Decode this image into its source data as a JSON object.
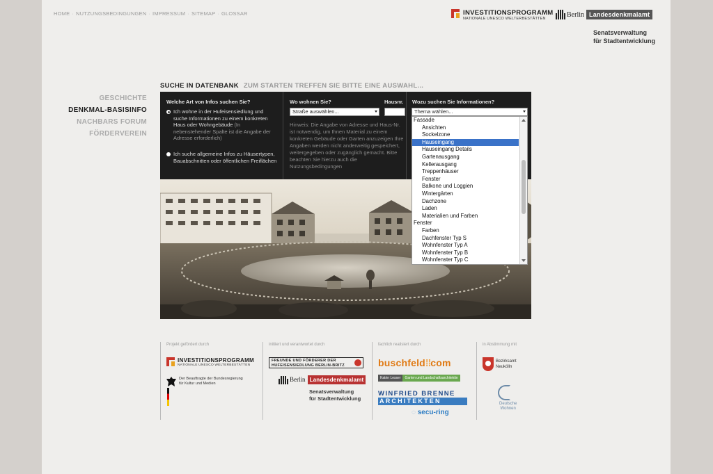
{
  "topnav": [
    "HOME",
    "NUTZUNGSBEDINGUNGEN",
    "IMPRESSUM",
    "SITEMAP",
    "GLOSSAR"
  ],
  "topnav_sep": "·",
  "header": {
    "ip_title": "INVESTITIONSPROGRAMM",
    "ip_sub": "NATIONALE UNESCO WELTERBESTÄTTEN",
    "berlin": "Berlin",
    "landesdenkmalamt": "Landesdenkmalamt",
    "senats_1": "Senatsverwaltung",
    "senats_2": "für Stadtentwicklung"
  },
  "sidenav": [
    "GESCHICHTE",
    "DENKMAL-BASISINFO",
    "NACHBARS FORUM",
    "FÖRDERVEREIN"
  ],
  "sidenav_active": 1,
  "search": {
    "title": "SUCHE IN DATENBANK",
    "subtitle": "ZUM STARTEN TREFFEN SIE BITTE EINE AUSWAHL...",
    "col1_heading": "Welche Art von Infos suchen Sie?",
    "radio1": "Ich wohne in der Hufeisensiedlung und suche Informationen zu einem konkreten Haus oder Wohngebäude",
    "radio1_note": "(In nebenstehender Spalte ist die Angabe der Adresse erforderlich)",
    "radio2": "Ich suche allgemeine Infos zu Häusertypen, Bauabschnitten oder öffentlichen Freiflächen",
    "col2_heading": "Wo wohnen Sie?",
    "hausnr_heading": "Hausnr.",
    "street_select": "Straße auswählen...",
    "hausnr_value": "",
    "hint": "Hinweis: Die Angabe von Adresse und Haus-Nr. ist notwendig, um Ihnen Material zu einem konkreten Gebäude oder Garten anzuzeigen Ihre Angaben werden nicht anderweitig gespeichert, weitergegeben oder zugänglich gemacht. Bitte beachten Sie hierzu auch die Nutzungsbedingungen",
    "col3_heading": "Wozu suchen Sie Informationen?",
    "topic_select": "Thema wählen..."
  },
  "dropdown": [
    {
      "label": "Fassade",
      "group": true
    },
    {
      "label": "Ansichten"
    },
    {
      "label": "Sockelzone"
    },
    {
      "label": "Hauseingang",
      "selected": true
    },
    {
      "label": "Hauseingang Details"
    },
    {
      "label": "Gartenausgang"
    },
    {
      "label": "Kellerausgang"
    },
    {
      "label": "Treppenhäuser"
    },
    {
      "label": "Fenster"
    },
    {
      "label": "Balkone und Loggien"
    },
    {
      "label": "Wintergärten"
    },
    {
      "label": "Dachzone"
    },
    {
      "label": "Laden"
    },
    {
      "label": "Materialien und Farben"
    },
    {
      "label": "Fenster",
      "group": true
    },
    {
      "label": "Farben"
    },
    {
      "label": "Dachfenster Typ S"
    },
    {
      "label": "Wohnfenster Typ A"
    },
    {
      "label": "Wohnfenster Typ B"
    },
    {
      "label": "Wohnfenster Typ C"
    }
  ],
  "sponsors": {
    "cap1": "Projekt gefördert durch",
    "cap2": "initiiert und verantwortet durch",
    "cap3": "fachlich realisiert durch",
    "cap4": "in Abstimmung mit",
    "bkm_1": "Der Beauftragte der Bundesregierung",
    "bkm_2": "für Kultur und Medien",
    "freunde_1": "FREUNDE UND FÖRDERER DER",
    "freunde_2": "HUFEISENSIEDLUNG BERLIN-BRITZ",
    "buschfeld": "buschfeld",
    "buschfeld_com": "com",
    "lesser_a": "Katrin Lesser",
    "lesser_b": "Garten und Landschaftsarchitektin",
    "brenne_1": "WINFRIED BRENNE",
    "brenne_2": "ARCHITEKTEN",
    "secu": "secu-ring",
    "nk_1": "Bezirksamt",
    "nk_2": "Neukölln",
    "dw_1": "Deutsche",
    "dw_2": "Wohnen"
  },
  "colors": {
    "accent_red": "#c9352b",
    "accent_yellow": "#e9a21f",
    "panel_bg": "#1d1d1d",
    "select_highlight": "#3a72c8"
  }
}
